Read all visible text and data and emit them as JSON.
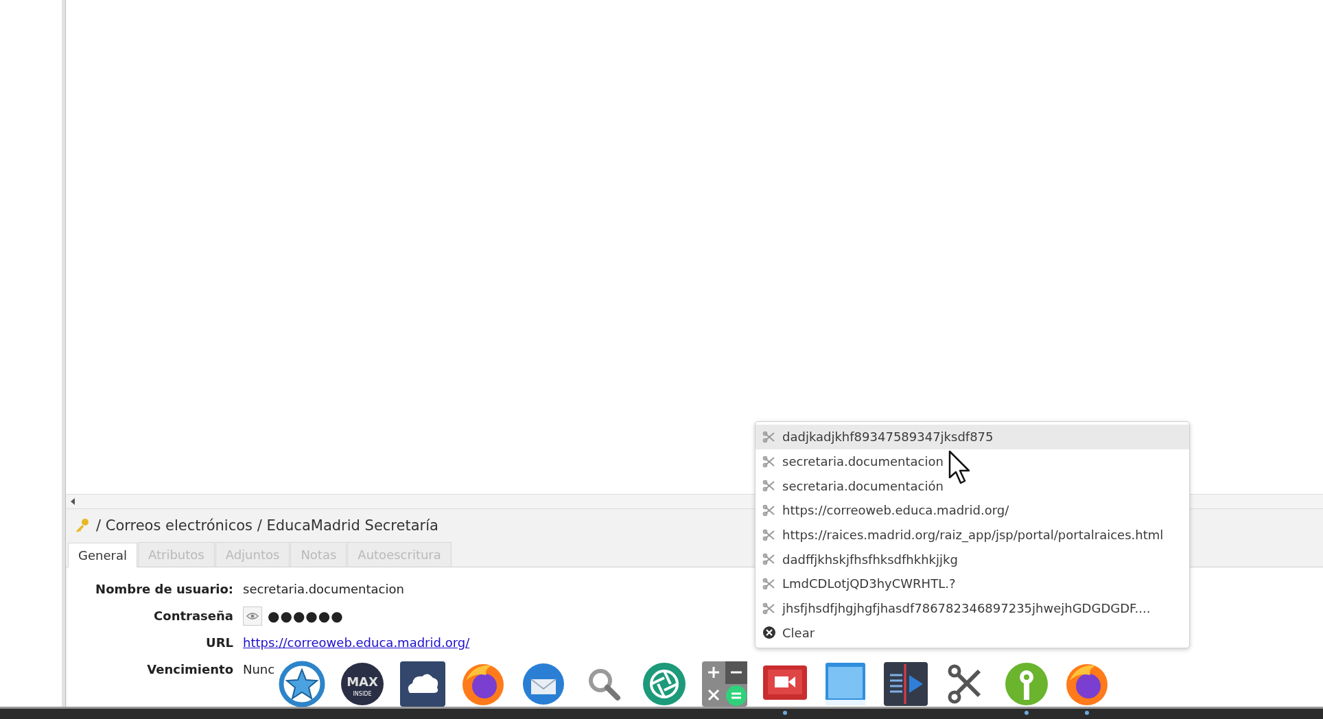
{
  "entry_path": {
    "text": "/ Correos electrónicos / EducaMadrid Secretaría"
  },
  "tabs": [
    {
      "label": "General",
      "selected": true,
      "disabled": false
    },
    {
      "label": "Atributos",
      "selected": false,
      "disabled": true
    },
    {
      "label": "Adjuntos",
      "selected": false,
      "disabled": true
    },
    {
      "label": "Notas",
      "selected": false,
      "disabled": true
    },
    {
      "label": "Autoescritura",
      "selected": false,
      "disabled": true
    }
  ],
  "fields": [
    {
      "kind": "text",
      "label": "Nombre de usuario:",
      "value": "secretaria.documentacion"
    },
    {
      "kind": "password",
      "label": "Contraseña",
      "value": "●●●●●●"
    },
    {
      "kind": "link",
      "label": "URL",
      "value": "https://correoweb.educa.madrid.org/"
    },
    {
      "kind": "text",
      "label": "Vencimiento",
      "value": "Nunc"
    }
  ],
  "clipboard_menu": {
    "items": [
      {
        "kind": "entry",
        "text": "dadjkadjkhf89347589347jksdf875",
        "selected": true
      },
      {
        "kind": "entry",
        "text": "secretaria.documentacion",
        "selected": false
      },
      {
        "kind": "entry",
        "text": "secretaria.documentación",
        "selected": false
      },
      {
        "kind": "entry",
        "text": "https://correoweb.educa.madrid.org/",
        "selected": false
      },
      {
        "kind": "entry",
        "text": "https://raices.madrid.org/raiz_app/jsp/portal/portalraices.html",
        "selected": false
      },
      {
        "kind": "entry",
        "text": "dadffjkhskjfhsfhksdfhkhkjjkg",
        "selected": false
      },
      {
        "kind": "entry",
        "text": "LmdCDLotjQD3hyCWRHTL.?",
        "selected": false
      },
      {
        "kind": "entry",
        "text": "jhsfjhsdfjhgjhgfjhasdf786782346897235jhwejhGDGDGDF....",
        "selected": false
      },
      {
        "kind": "clear",
        "text": "Clear",
        "selected": false
      }
    ]
  },
  "dock": [
    {
      "kind": "star",
      "running": false
    },
    {
      "kind": "max",
      "label": "MAX",
      "sublabel": "INSIDE",
      "running": false
    },
    {
      "kind": "cloud",
      "running": false
    },
    {
      "kind": "firefox",
      "running": false
    },
    {
      "kind": "mail",
      "running": false
    },
    {
      "kind": "search",
      "running": false
    },
    {
      "kind": "aperture",
      "running": false
    },
    {
      "kind": "calculator",
      "running": false
    },
    {
      "kind": "recorder",
      "running": true
    },
    {
      "kind": "window",
      "running": false
    },
    {
      "kind": "video",
      "running": false
    },
    {
      "kind": "scissors",
      "running": false
    },
    {
      "kind": "key",
      "running": true
    },
    {
      "kind": "firefox",
      "running": true
    }
  ]
}
